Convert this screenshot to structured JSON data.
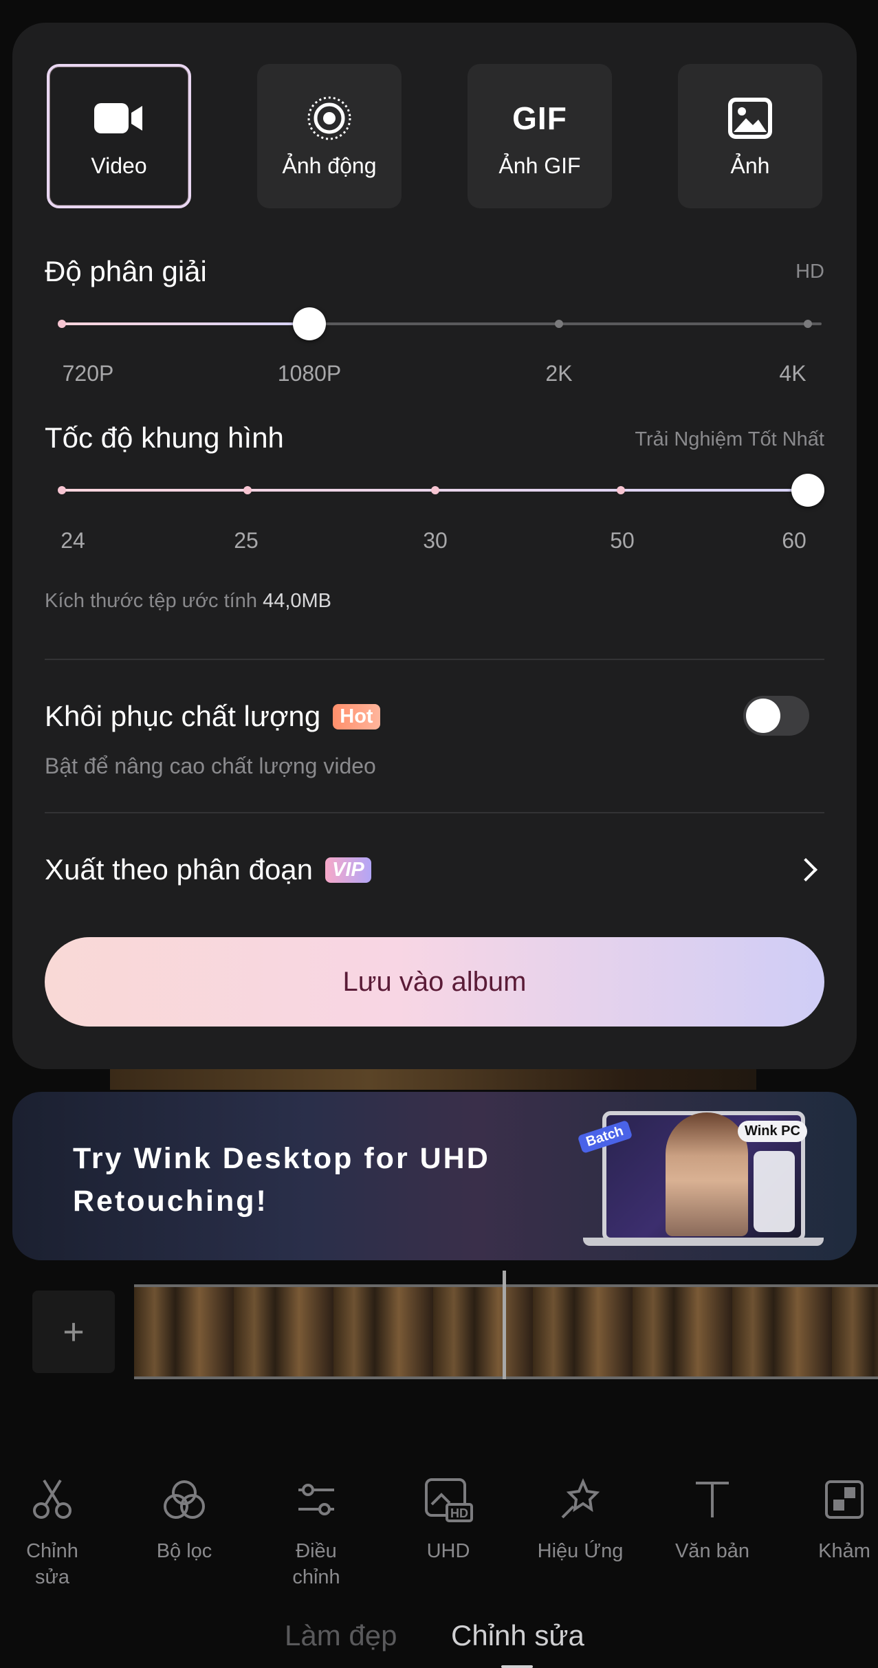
{
  "export_types": [
    {
      "label": "Video",
      "icon": "video-camera-icon",
      "active": true
    },
    {
      "label": "Ảnh động",
      "icon": "live-photo-icon",
      "active": false
    },
    {
      "label": "Ảnh GIF",
      "icon_text": "GIF",
      "icon": "gif-icon",
      "active": false
    },
    {
      "label": "Ảnh",
      "icon": "image-icon",
      "active": false
    }
  ],
  "resolution": {
    "title": "Độ phân giải",
    "badge": "HD",
    "options": [
      "720P",
      "1080P",
      "2K",
      "4K"
    ],
    "selected_index": 1
  },
  "frame_rate": {
    "title": "Tốc độ khung hình",
    "badge": "Trải Nghiệm Tốt Nhất",
    "options": [
      "24",
      "25",
      "30",
      "50",
      "60"
    ],
    "selected_index": 4
  },
  "file_size": {
    "label": "Kích thước tệp ước tính",
    "value": "44,0MB"
  },
  "quality_restore": {
    "title": "Khôi phục chất lượng",
    "badge": "Hot",
    "subtitle": "Bật để nâng cao chất lượng video",
    "enabled": false
  },
  "segment_export": {
    "title": "Xuất theo phân đoạn",
    "badge": "VIP"
  },
  "save_button": "Lưu vào album",
  "banner": {
    "text": "Try Wink Desktop for UHD Retouching!",
    "batch_tag": "Batch",
    "product_tag": "Wink PC"
  },
  "timeline": {
    "add_label": "+"
  },
  "tools": [
    {
      "label": "Chỉnh\nsửa",
      "icon": "scissors-icon"
    },
    {
      "label": "Bộ lọc",
      "icon": "filter-icon"
    },
    {
      "label": "Điều\nchỉnh",
      "icon": "adjust-icon"
    },
    {
      "label": "UHD",
      "icon": "uhd-icon"
    },
    {
      "label": "Hiệu Ứng",
      "icon": "effects-icon"
    },
    {
      "label": "Văn bản",
      "icon": "text-icon"
    },
    {
      "label": "Khảm",
      "icon": "mosaic-icon"
    }
  ],
  "tabs": [
    {
      "label": "Làm đẹp",
      "active": false
    },
    {
      "label": "Chỉnh sửa",
      "active": true
    }
  ]
}
